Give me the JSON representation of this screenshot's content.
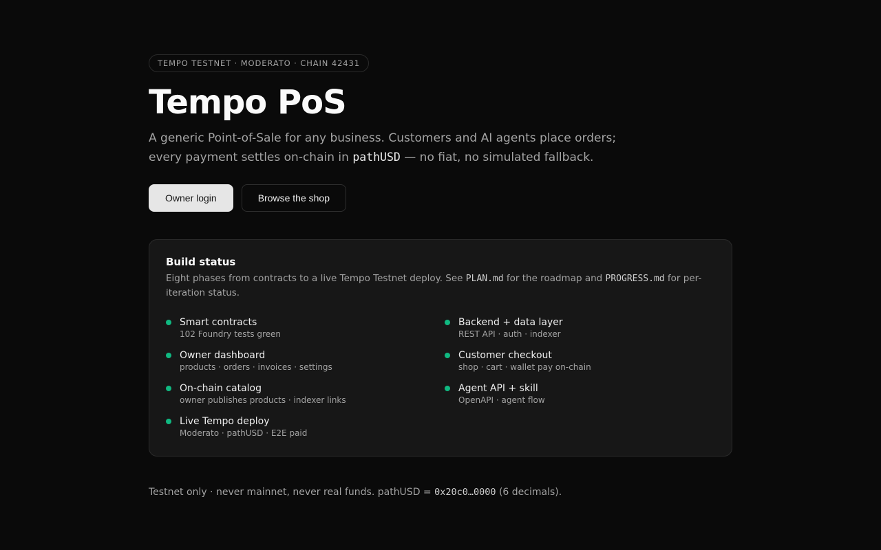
{
  "header": {
    "network_pill": "TEMPO TESTNET · MODERATO · CHAIN 42431",
    "title": "Tempo PoS",
    "lead_part1": "A generic Point-of-Sale for any business. Customers and AI agents place orders; every payment settles on-chain in ",
    "lead_code": "pathUSD",
    "lead_part2": " — no fiat, no simulated fallback."
  },
  "actions": {
    "owner_login": "Owner login",
    "browse_shop": "Browse the shop"
  },
  "build_status": {
    "title": "Build status",
    "desc_part1": "Eight phases from contracts to a live Tempo Testnet deploy. See ",
    "desc_code1": "PLAN.md",
    "desc_part2": " for the roadmap and ",
    "desc_code2": "PROGRESS.md",
    "desc_part3": " for per-iteration status.",
    "status_color": "#10b981",
    "phases": [
      {
        "name": "Smart contracts",
        "detail": "102 Foundry tests green"
      },
      {
        "name": "Backend + data layer",
        "detail": "REST API · auth · indexer"
      },
      {
        "name": "Owner dashboard",
        "detail": "products · orders · invoices · settings"
      },
      {
        "name": "Customer checkout",
        "detail": "shop · cart · wallet pay on-chain"
      },
      {
        "name": "On-chain catalog",
        "detail": "owner publishes products · indexer links"
      },
      {
        "name": "Agent API + skill",
        "detail": "OpenAPI · agent flow"
      },
      {
        "name": "Live Tempo deploy",
        "detail": "Moderato · pathUSD · E2E paid"
      }
    ]
  },
  "footer": {
    "part1": "Testnet only · never mainnet, never real funds. pathUSD = ",
    "code": "0x20c0…0000",
    "part2": " (6 decimals)."
  }
}
